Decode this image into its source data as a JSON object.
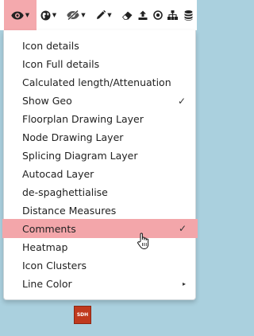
{
  "toolbar": {
    "buttons": [
      {
        "icon": "eye-icon",
        "dropdown": true,
        "active": true
      },
      {
        "icon": "globe-icon",
        "dropdown": true,
        "active": false
      },
      {
        "icon": "eye-slash-icon",
        "dropdown": true,
        "active": false
      },
      {
        "icon": "pencil-icon",
        "dropdown": true,
        "active": false
      },
      {
        "icon": "eraser-icon",
        "dropdown": false,
        "active": false
      },
      {
        "icon": "upload-icon",
        "dropdown": false,
        "active": false
      },
      {
        "icon": "dot-circle-icon",
        "dropdown": false,
        "active": false
      },
      {
        "icon": "sitemap-icon",
        "dropdown": false,
        "active": false
      },
      {
        "icon": "database-icon",
        "dropdown": false,
        "active": false
      }
    ]
  },
  "menu": {
    "items": [
      {
        "label": "Icon details",
        "checked": false
      },
      {
        "label": "Icon Full details",
        "checked": false
      },
      {
        "label": "Calculated length/Attenuation",
        "checked": false
      },
      {
        "label": "Show Geo",
        "checked": true,
        "mark": "✓"
      },
      {
        "label": "Floorplan Drawing Layer",
        "checked": false
      },
      {
        "label": "Node Drawing Layer",
        "checked": false
      },
      {
        "label": "Splicing Diagram Layer",
        "checked": false
      },
      {
        "label": "Autocad Layer",
        "checked": false
      },
      {
        "label": "de-spaghettialise",
        "checked": false
      },
      {
        "label": "Distance Measures",
        "checked": false
      },
      {
        "label": "Comments",
        "checked": true,
        "mark": "✓",
        "highlighted": true
      },
      {
        "label": "Heatmap",
        "checked": false
      },
      {
        "label": "Icon Clusters",
        "checked": false
      },
      {
        "label": "Line Color",
        "checked": false,
        "submenu": true,
        "arrow": "▸"
      }
    ]
  },
  "map_marker": {
    "label": "SDH"
  },
  "colors": {
    "highlight": "#f3a6aa",
    "map_background": "#aad0de",
    "marker": "#c0391d"
  }
}
